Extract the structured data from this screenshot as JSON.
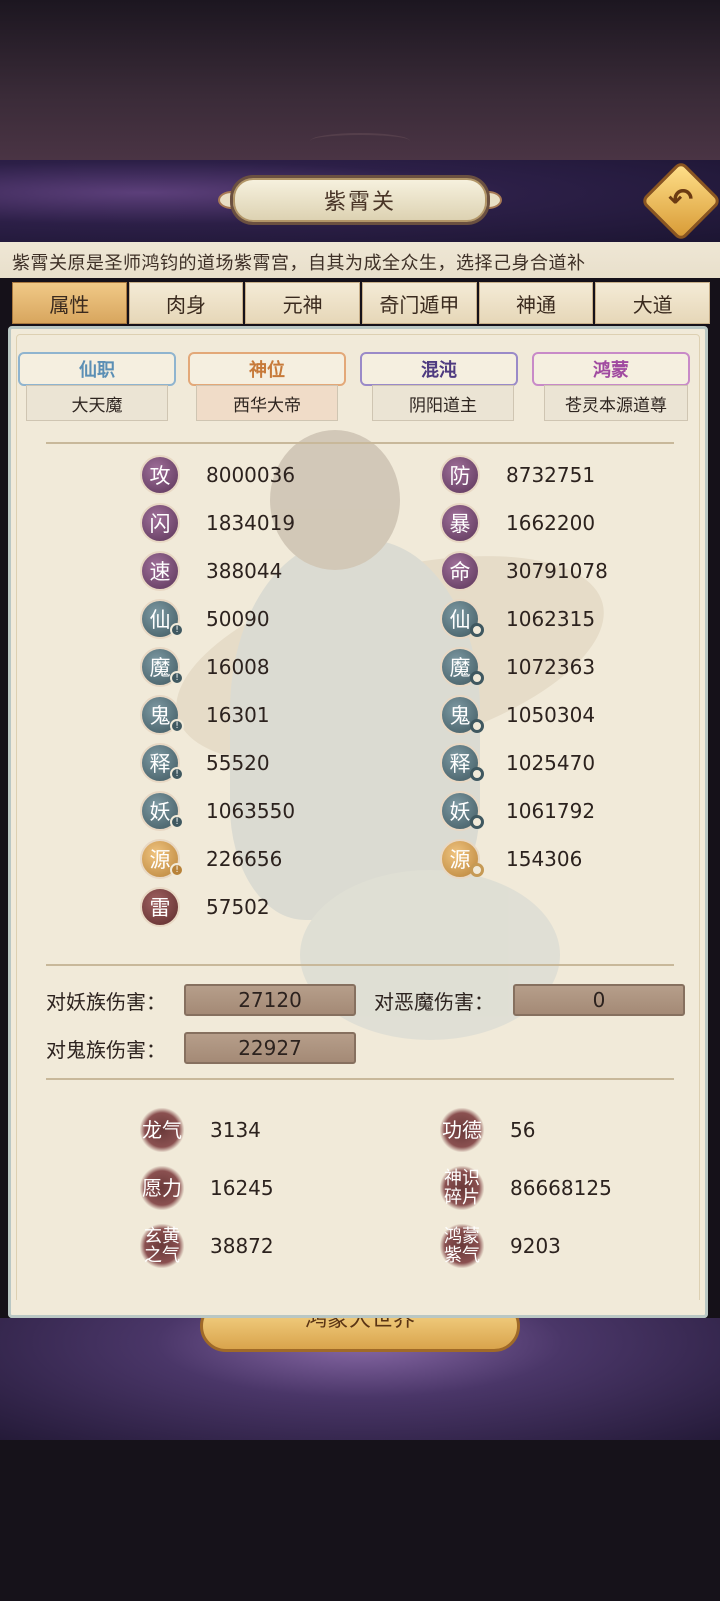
{
  "header": {
    "title": "紫霄关",
    "back_icon": "return-arrow-icon"
  },
  "description": "紫霄关原是圣师鸿钧的道场紫霄宫，自其为成全众生，选择己身合道补",
  "tabs": [
    {
      "label": "属性",
      "active": true
    },
    {
      "label": "肉身",
      "active": false
    },
    {
      "label": "元神",
      "active": false
    },
    {
      "label": "奇门遁甲",
      "active": false
    },
    {
      "label": "神通",
      "active": false
    },
    {
      "label": "大道",
      "active": false
    }
  ],
  "titles": [
    {
      "category": "仙职",
      "value": "大天魔",
      "color": "#5b8fb5"
    },
    {
      "category": "神位",
      "value": "西华大帝",
      "color": "#c77a3a"
    },
    {
      "category": "混沌",
      "value": "阴阳道主",
      "color": "#4e3a80"
    },
    {
      "category": "鸿蒙",
      "value": "苍灵本源道尊",
      "color": "#a04aa0"
    }
  ],
  "stats_left": [
    {
      "icon": "攻",
      "value": "8000036",
      "style": "purple"
    },
    {
      "icon": "闪",
      "value": "1834019",
      "style": "purple"
    },
    {
      "icon": "速",
      "value": "388044",
      "style": "purple"
    },
    {
      "icon": "仙",
      "value": "50090",
      "style": "teal"
    },
    {
      "icon": "魔",
      "value": "16008",
      "style": "teal"
    },
    {
      "icon": "鬼",
      "value": "16301",
      "style": "teal"
    },
    {
      "icon": "释",
      "value": "55520",
      "style": "teal"
    },
    {
      "icon": "妖",
      "value": "1063550",
      "style": "teal"
    },
    {
      "icon": "源",
      "value": "226656",
      "style": "amber"
    },
    {
      "icon": "雷",
      "value": "57502",
      "style": "red"
    }
  ],
  "stats_right": [
    {
      "icon": "防",
      "value": "8732751",
      "style": "purple"
    },
    {
      "icon": "暴",
      "value": "1662200",
      "style": "purple"
    },
    {
      "icon": "命",
      "value": "30791078",
      "style": "purple"
    },
    {
      "icon": "仙",
      "value": "1062315",
      "style": "teal"
    },
    {
      "icon": "魔",
      "value": "1072363",
      "style": "teal"
    },
    {
      "icon": "鬼",
      "value": "1050304",
      "style": "teal"
    },
    {
      "icon": "释",
      "value": "1025470",
      "style": "teal"
    },
    {
      "icon": "妖",
      "value": "1061792",
      "style": "teal"
    },
    {
      "icon": "源",
      "value": "154306",
      "style": "amber"
    }
  ],
  "damage": {
    "yao_label": "对妖族伤害：",
    "yao_value": "27120",
    "demon_label": "对恶魔伤害：",
    "demon_value": "0",
    "ghost_label": "对鬼族伤害：",
    "ghost_value": "22927"
  },
  "resources": {
    "dragon_qi_label": "龙气",
    "dragon_qi_value": "3134",
    "merit_label": "功德",
    "merit_value": "56",
    "wish_label": "愿力",
    "wish_value": "16245",
    "shard_label_1": "神识",
    "shard_label_2": "碎片",
    "shard_value": "86668125",
    "xuanhuang_label_1": "玄黄",
    "xuanhuang_label_2": "之气",
    "xuanhuang_value": "38872",
    "hongmeng_label_1": "鸿蒙",
    "hongmeng_label_2": "紫气",
    "hongmeng_value": "9203"
  },
  "bottom_plate": "鸿蒙大世界"
}
